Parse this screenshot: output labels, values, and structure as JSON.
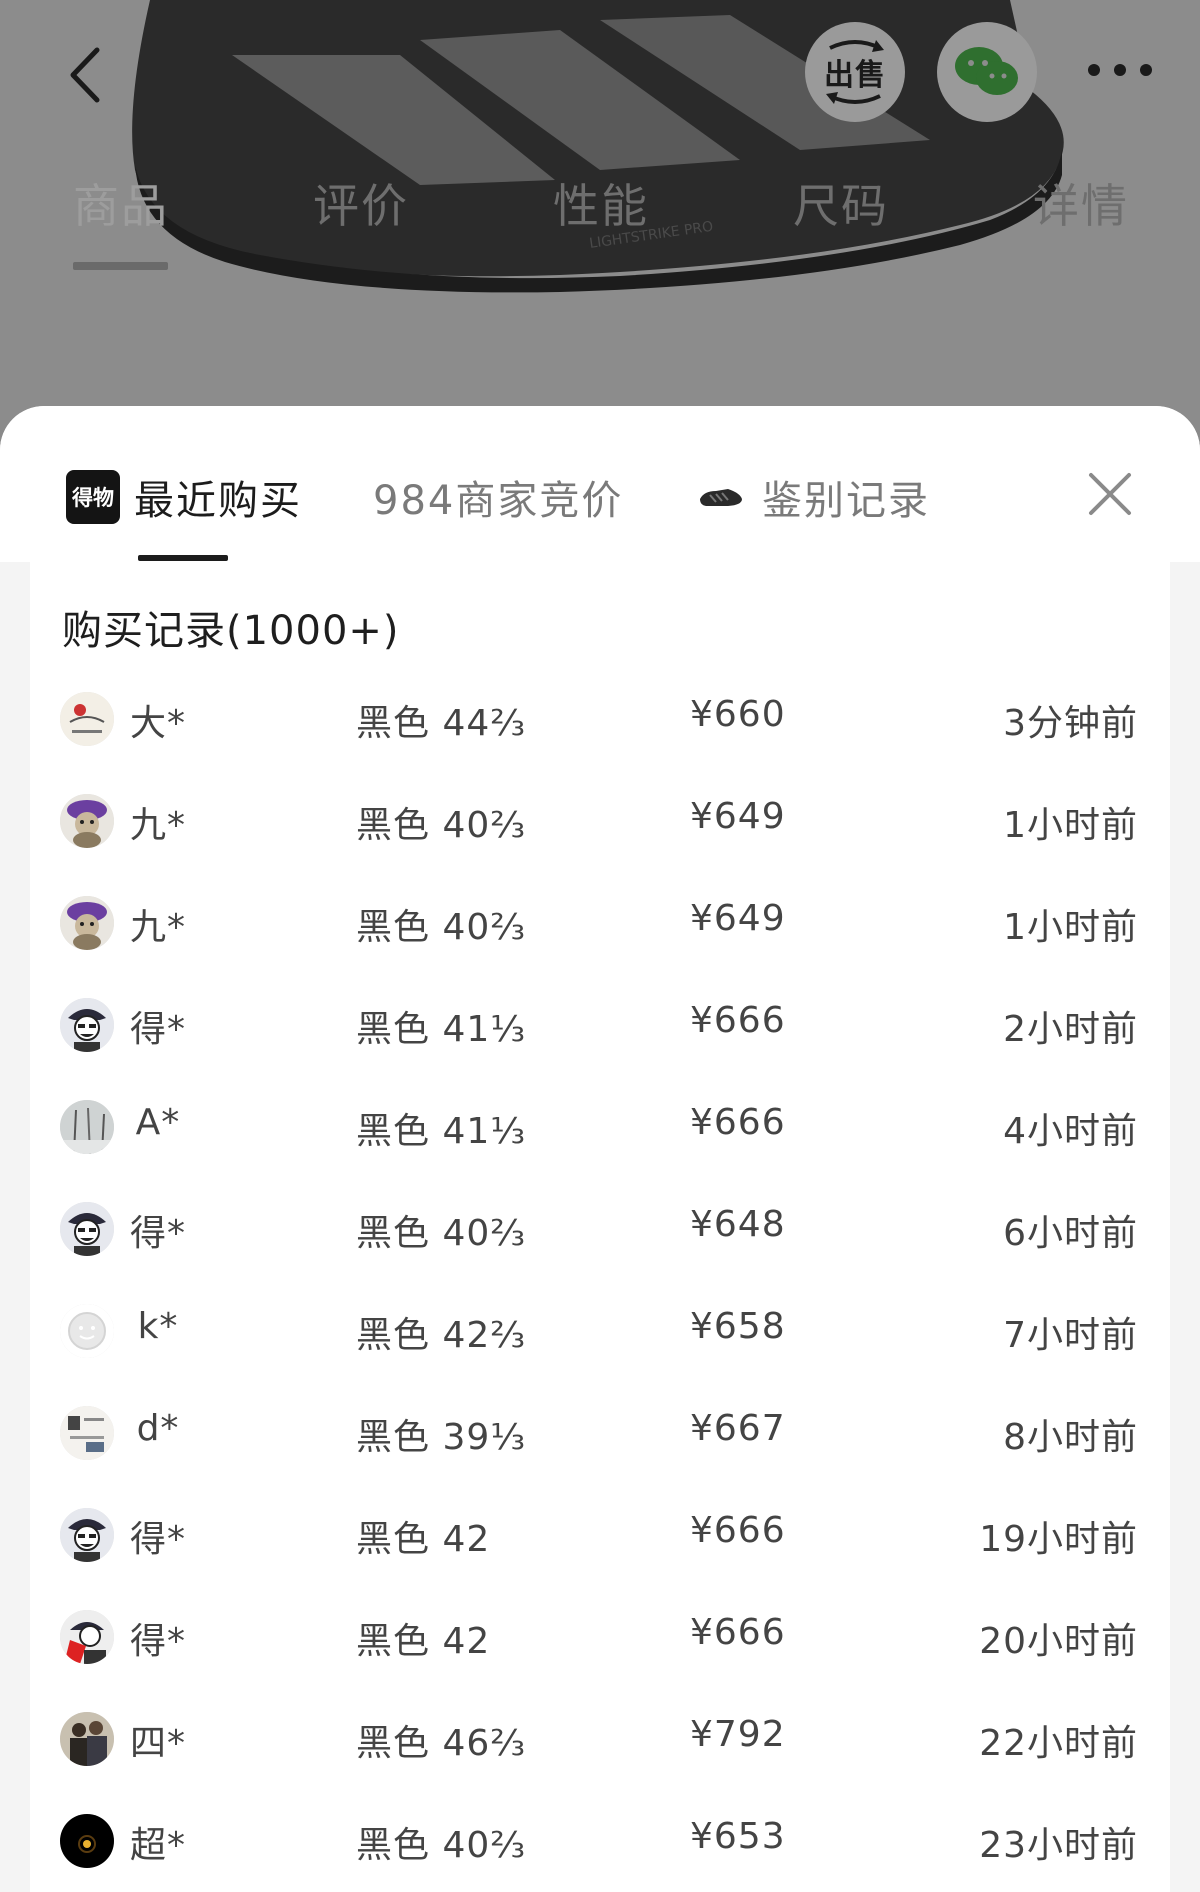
{
  "header": {
    "sell_label": "出售",
    "product_tabs": [
      {
        "label": "商品",
        "active": true
      },
      {
        "label": "评价",
        "active": false
      },
      {
        "label": "性能",
        "active": false
      },
      {
        "label": "尺码",
        "active": false
      },
      {
        "label": "详情",
        "active": false
      }
    ]
  },
  "sheet": {
    "tabs": {
      "recent_logo": "得物",
      "recent": "最近购买",
      "bids": "984商家竞价",
      "auth": "鉴别记录"
    },
    "title": "购买记录(1000+)",
    "records": [
      {
        "user": "大*",
        "spec": "黑色 44⅔",
        "price": "¥660",
        "time": "3分钟前",
        "avatar": "ink-avatar"
      },
      {
        "user": "九*",
        "spec": "黑色 40⅔",
        "price": "¥649",
        "time": "1小时前",
        "avatar": "monkey-avatar"
      },
      {
        "user": "九*",
        "spec": "黑色 40⅔",
        "price": "¥649",
        "time": "1小时前",
        "avatar": "monkey-avatar"
      },
      {
        "user": "得*",
        "spec": "黑色 41⅓",
        "price": "¥666",
        "time": "2小时前",
        "avatar": "cartoon-avatar"
      },
      {
        "user": "A*",
        "spec": "黑色 41⅓",
        "price": "¥666",
        "time": "4小时前",
        "avatar": "snow-avatar"
      },
      {
        "user": "得*",
        "spec": "黑色 40⅔",
        "price": "¥648",
        "time": "6小时前",
        "avatar": "cartoon-avatar"
      },
      {
        "user": "k*",
        "spec": "黑色 42⅔",
        "price": "¥658",
        "time": "7小时前",
        "avatar": "default-avatar"
      },
      {
        "user": "d*",
        "spec": "黑色 39⅓",
        "price": "¥667",
        "time": "8小时前",
        "avatar": "text-avatar"
      },
      {
        "user": "得*",
        "spec": "黑色 42",
        "price": "¥666",
        "time": "19小时前",
        "avatar": "cartoon-avatar"
      },
      {
        "user": "得*",
        "spec": "黑色 42",
        "price": "¥666",
        "time": "20小时前",
        "avatar": "red-cartoon-avatar"
      },
      {
        "user": "四*",
        "spec": "黑色 46⅔",
        "price": "¥792",
        "time": "22小时前",
        "avatar": "couple-avatar"
      },
      {
        "user": "超*",
        "spec": "黑色 40⅔",
        "price": "¥653",
        "time": "23小时前",
        "avatar": "dark-avatar"
      }
    ]
  },
  "colors": {
    "overlay": "#8c8c8c",
    "sheet_bg": "#f4f4f4",
    "card_bg": "#ffffff",
    "text_primary": "#1c1c1c",
    "text_secondary": "#444444",
    "tab_inactive": "#7a7a7a"
  }
}
